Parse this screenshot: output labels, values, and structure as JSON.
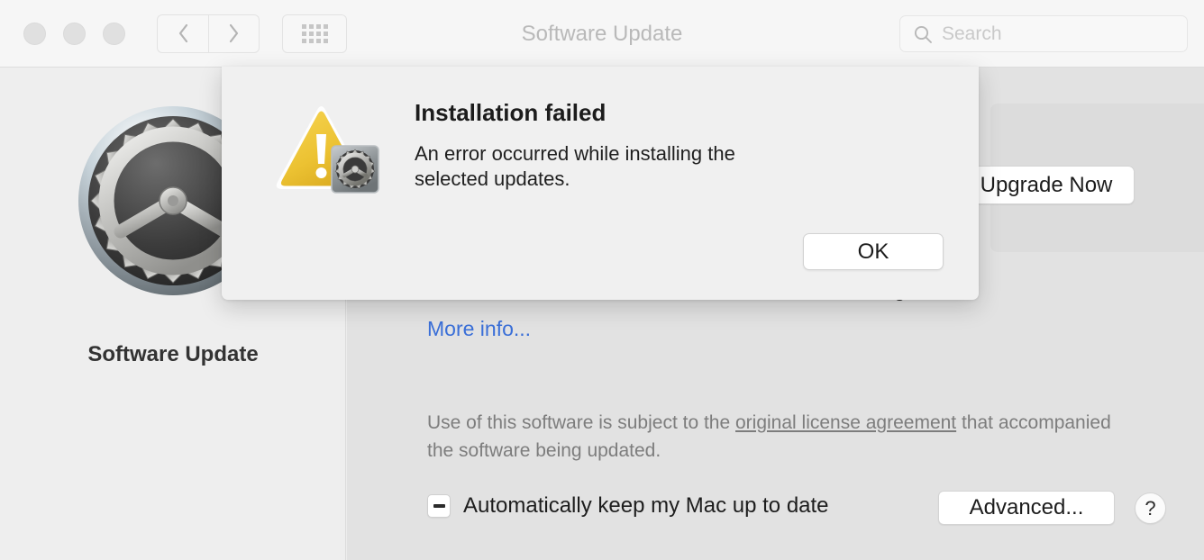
{
  "window": {
    "title": "Software Update",
    "traffic_lights": [
      "close",
      "minimize",
      "zoom"
    ],
    "nav": {
      "back_icon": "chevron-left-icon",
      "forward_icon": "chevron-right-icon",
      "grid_icon": "show-all-grid-icon"
    },
    "search": {
      "placeholder": "Search",
      "value": "",
      "icon": "search-icon"
    }
  },
  "sidebar": {
    "icon": "software-update-gear-icon",
    "label": "Software Update"
  },
  "content": {
    "upgrade_button": "Upgrade Now",
    "tonight_text": "er tonight.",
    "more_info_link": "More info...",
    "license_prefix": "Use of this software is subject to the ",
    "license_link": "original license agreement",
    "license_suffix": " that accompanied the software being updated.",
    "auto_update_label": "Automatically keep my Mac up to date",
    "auto_update_state": "mixed",
    "advanced_button": "Advanced...",
    "help_button": "?"
  },
  "dialog": {
    "icon": "warning-triangle-with-gear-badge-icon",
    "title": "Installation failed",
    "message": "An error occurred while installing the selected updates.",
    "ok_button": "OK"
  },
  "colors": {
    "titlebar_bg": "#f6f6f6",
    "sidebar_bg": "#eeeeee",
    "content_bg": "#e2e2e2",
    "sheet_bg": "#f0f0f0",
    "link_blue": "#3a6fd8",
    "warning_yellow": "#edc13a"
  }
}
